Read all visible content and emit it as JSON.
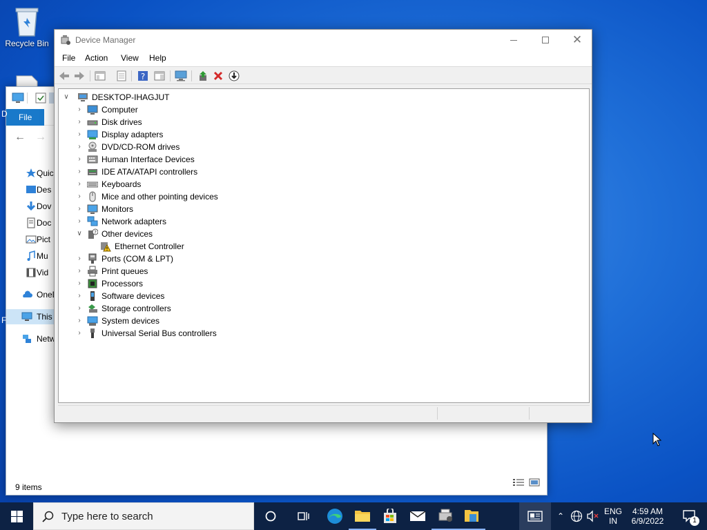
{
  "desktop": {
    "icons": [
      {
        "label": "Recycle Bin",
        "icon": "recycle-bin-icon"
      },
      {
        "label": "",
        "icon": "document-icon"
      }
    ]
  },
  "explorer": {
    "file_tab": "File",
    "nav_items": [
      {
        "label": "Quic",
        "icon": "star-icon"
      },
      {
        "label": "Des",
        "icon": "desktop-icon"
      },
      {
        "label": "Dov",
        "icon": "download-icon"
      },
      {
        "label": "Doc",
        "icon": "documents-icon"
      },
      {
        "label": "Pict",
        "icon": "pictures-icon"
      },
      {
        "label": "Mu",
        "icon": "music-icon"
      },
      {
        "label": "Vid",
        "icon": "videos-icon"
      },
      {
        "label": "OneD",
        "icon": "onedrive-icon"
      },
      {
        "label": "This I",
        "icon": "this-pc-icon"
      },
      {
        "label": "Netw",
        "icon": "network-icon"
      }
    ],
    "status": "9 items",
    "edge_letters": [
      "D",
      "F"
    ]
  },
  "devmgr": {
    "title": "Device Manager",
    "menu": [
      "File",
      "Action",
      "View",
      "Help"
    ],
    "root": "DESKTOP-IHAGJUT",
    "tree": [
      {
        "label": "Computer",
        "icon": "computer-icon",
        "expanded": false
      },
      {
        "label": "Disk drives",
        "icon": "disk-drive-icon",
        "expanded": false
      },
      {
        "label": "Display adapters",
        "icon": "display-adapter-icon",
        "expanded": false
      },
      {
        "label": "DVD/CD-ROM drives",
        "icon": "dvd-drive-icon",
        "expanded": false
      },
      {
        "label": "Human Interface Devices",
        "icon": "hid-icon",
        "expanded": false
      },
      {
        "label": "IDE ATA/ATAPI controllers",
        "icon": "ide-controller-icon",
        "expanded": false
      },
      {
        "label": "Keyboards",
        "icon": "keyboard-icon",
        "expanded": false
      },
      {
        "label": "Mice and other pointing devices",
        "icon": "mouse-icon",
        "expanded": false
      },
      {
        "label": "Monitors",
        "icon": "monitor-icon",
        "expanded": false
      },
      {
        "label": "Network adapters",
        "icon": "network-adapter-icon",
        "expanded": false
      },
      {
        "label": "Other devices",
        "icon": "unknown-device-icon",
        "expanded": true,
        "children": [
          {
            "label": "Ethernet Controller",
            "icon": "warning-device-icon"
          }
        ]
      },
      {
        "label": "Ports (COM & LPT)",
        "icon": "port-icon",
        "expanded": false
      },
      {
        "label": "Print queues",
        "icon": "printer-icon",
        "expanded": false
      },
      {
        "label": "Processors",
        "icon": "processor-icon",
        "expanded": false
      },
      {
        "label": "Software devices",
        "icon": "software-device-icon",
        "expanded": false
      },
      {
        "label": "Storage controllers",
        "icon": "storage-controller-icon",
        "expanded": false
      },
      {
        "label": "System devices",
        "icon": "system-device-icon",
        "expanded": false
      },
      {
        "label": "Universal Serial Bus controllers",
        "icon": "usb-icon",
        "expanded": false
      }
    ]
  },
  "taskbar": {
    "search_placeholder": "Type here to search",
    "lang_top": "ENG",
    "lang_bottom": "IN",
    "time": "4:59 AM",
    "date": "6/9/2022",
    "notification_count": "1"
  },
  "colors": {
    "accent": "#1979ca",
    "taskbar": "#0d2244",
    "desktop": "#1f6fd8",
    "warning": "#f5c518",
    "delete_red": "#d42a2a"
  }
}
